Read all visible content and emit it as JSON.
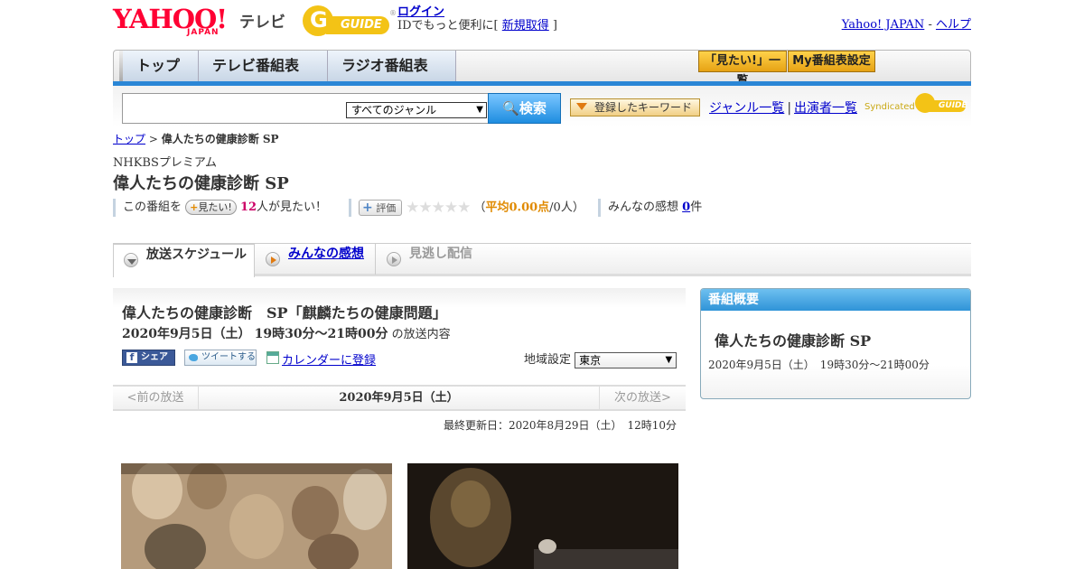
{
  "header": {
    "logo_text": "YAHOO!",
    "logo_sub": "JAPAN",
    "service_name": "テレビ",
    "gguide_text": "GUIDE",
    "login_label": "ログイン",
    "login_desc_prefix": "IDでもっと便利に[ ",
    "signup_label": "新規取得",
    "login_desc_suffix": " ]",
    "yahoo_japan_link": "Yahoo! JAPAN",
    "link_sep": " - ",
    "help_link": "ヘルプ"
  },
  "nav": {
    "tabs": [
      "トップ",
      "テレビ番組表",
      "ラジオ番組表"
    ],
    "mitai_list": "「見たい!」一覧",
    "my_bangumi": "My番組表設定"
  },
  "search": {
    "input_value": "",
    "genre_selected": "すべてのジャンル",
    "search_button": "検索",
    "keyword_button": "登録したキーワード",
    "genre_list_link": "ジャンル一覧",
    "separator": "|",
    "performer_list_link": "出演者一覧",
    "syndicated": "Syndicated",
    "syndicated_logo": "GUIDE"
  },
  "breadcrumb": {
    "top": "トップ",
    "sep": " > ",
    "current": "偉人たちの健康診断 SP"
  },
  "program": {
    "channel": "NHKBSプレミアム",
    "title": "偉人たちの健康診断 SP",
    "mitai_prefix": "この番組を",
    "mitai_button": "見たい!",
    "mitai_count": "12",
    "mitai_suffix": "人が見たい！",
    "hyoka_button": "評価",
    "stars": "★★★★★",
    "avg_open": "（",
    "avg_label": "平均0.00点",
    "avg_people": "/0人）",
    "kansou_prefix": "みんなの感想 ",
    "kansou_count": "0",
    "kansou_suffix": "件"
  },
  "tabs": {
    "schedule": "放送スケジュール",
    "kansou": "みんなの感想",
    "minogashi": "見逃し配信"
  },
  "broadcast": {
    "title": "偉人たちの健康診断　SP「麒麟たちの健康問題」",
    "date": "2020年9月5日（土）",
    "time": "19時30分～21時00分",
    "date_suffix": "の放送内容",
    "fb_share": "シェア",
    "tweet": "ツイートする",
    "calendar": "カレンダーに登録",
    "region_label": "地域設定",
    "region_value": "東京",
    "prev": "<前の放送",
    "current": "2020年9月5日（土）",
    "next": "次の放送>",
    "updated": "最終更新日：2020年8月29日（土）　12時10分"
  },
  "overview": {
    "header": "番組概要",
    "title": "偉人たちの健康診断 SP",
    "date": "2020年9月5日（土）　19時30分～21時00分"
  }
}
